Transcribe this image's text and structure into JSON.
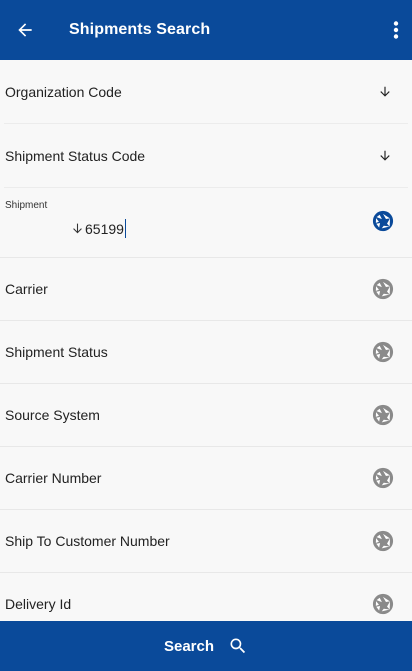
{
  "header": {
    "title": "Shipments Search",
    "back_icon": "arrow-left-icon",
    "menu_icon": "more-vert-icon"
  },
  "fields": {
    "organization_code": {
      "label": "Organization Code",
      "icon": "arrow-down-icon"
    },
    "shipment_status_code": {
      "label": "Shipment Status Code",
      "icon": "arrow-down-icon"
    },
    "shipment": {
      "label": "Shipment",
      "value": "65199",
      "icon": "aperture-icon",
      "icon_color": "#0a4a9a"
    },
    "carrier": {
      "label": "Carrier",
      "icon": "aperture-icon"
    },
    "shipment_status": {
      "label": "Shipment Status",
      "icon": "aperture-icon"
    },
    "source_system": {
      "label": "Source System",
      "icon": "aperture-icon"
    },
    "carrier_number": {
      "label": "Carrier Number",
      "icon": "aperture-icon"
    },
    "ship_to_customer_number": {
      "label": "Ship To Customer Number",
      "icon": "aperture-icon"
    },
    "delivery_id": {
      "label": "Delivery Id",
      "icon": "aperture-icon"
    }
  },
  "footer": {
    "search_label": "Search",
    "search_icon": "search-icon"
  },
  "colors": {
    "primary": "#0a4a9a",
    "icon_inactive": "#8a8a8a"
  }
}
